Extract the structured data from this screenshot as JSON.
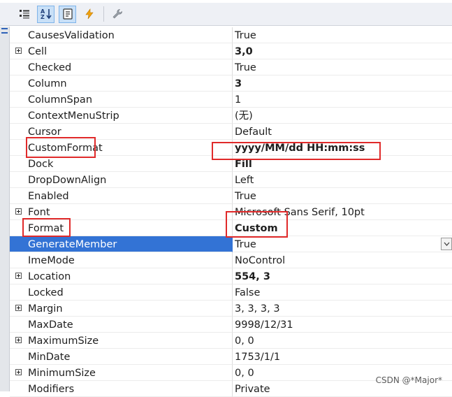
{
  "toolbar": {
    "buttons": [
      {
        "name": "categorized-button",
        "icon": "categorized-icon"
      },
      {
        "name": "alphabetical-button",
        "icon": "sort-alphabetical-icon"
      },
      {
        "name": "properties-button",
        "icon": "properties-page-icon"
      },
      {
        "name": "events-button",
        "icon": "lightning-icon"
      },
      {
        "name": "property-pages-button",
        "icon": "wrench-icon"
      }
    ]
  },
  "properties": [
    {
      "name": "CausesValidation",
      "value": "True",
      "bold": false,
      "expandable": false
    },
    {
      "name": "Cell",
      "value": "3,0",
      "bold": true,
      "expandable": true
    },
    {
      "name": "Checked",
      "value": "True",
      "bold": false,
      "expandable": false
    },
    {
      "name": "Column",
      "value": "3",
      "bold": true,
      "expandable": false
    },
    {
      "name": "ColumnSpan",
      "value": "1",
      "bold": false,
      "expandable": false
    },
    {
      "name": "ContextMenuStrip",
      "value": "(无)",
      "bold": false,
      "expandable": false
    },
    {
      "name": "Cursor",
      "value": "Default",
      "bold": false,
      "expandable": false
    },
    {
      "name": "CustomFormat",
      "value": "yyyy/MM/dd HH:mm:ss",
      "bold": true,
      "expandable": false
    },
    {
      "name": "Dock",
      "value": "Fill",
      "bold": true,
      "expandable": false
    },
    {
      "name": "DropDownAlign",
      "value": "Left",
      "bold": false,
      "expandable": false
    },
    {
      "name": "Enabled",
      "value": "True",
      "bold": false,
      "expandable": false
    },
    {
      "name": "Font",
      "value": "Microsoft Sans Serif, 10pt",
      "bold": false,
      "expandable": true
    },
    {
      "name": "Format",
      "value": "Custom",
      "bold": true,
      "expandable": false
    },
    {
      "name": "GenerateMember",
      "value": "True",
      "bold": false,
      "expandable": false,
      "selected": true
    },
    {
      "name": "ImeMode",
      "value": "NoControl",
      "bold": false,
      "expandable": false
    },
    {
      "name": "Location",
      "value": "554, 3",
      "bold": true,
      "expandable": true
    },
    {
      "name": "Locked",
      "value": "False",
      "bold": false,
      "expandable": false
    },
    {
      "name": "Margin",
      "value": "3, 3, 3, 3",
      "bold": false,
      "expandable": true
    },
    {
      "name": "MaxDate",
      "value": "9998/12/31",
      "bold": false,
      "expandable": false
    },
    {
      "name": "MaximumSize",
      "value": "0, 0",
      "bold": false,
      "expandable": true
    },
    {
      "name": "MinDate",
      "value": "1753/1/1",
      "bold": false,
      "expandable": false
    },
    {
      "name": "MinimumSize",
      "value": "0, 0",
      "bold": false,
      "expandable": true
    },
    {
      "name": "Modifiers",
      "value": "Private",
      "bold": false,
      "expandable": false
    }
  ],
  "colors": {
    "selection": "#3373d5",
    "annotation_red": "#e02a2a",
    "toolbar_bg": "#eef0f5"
  },
  "watermark": "CSDN @*Major*"
}
